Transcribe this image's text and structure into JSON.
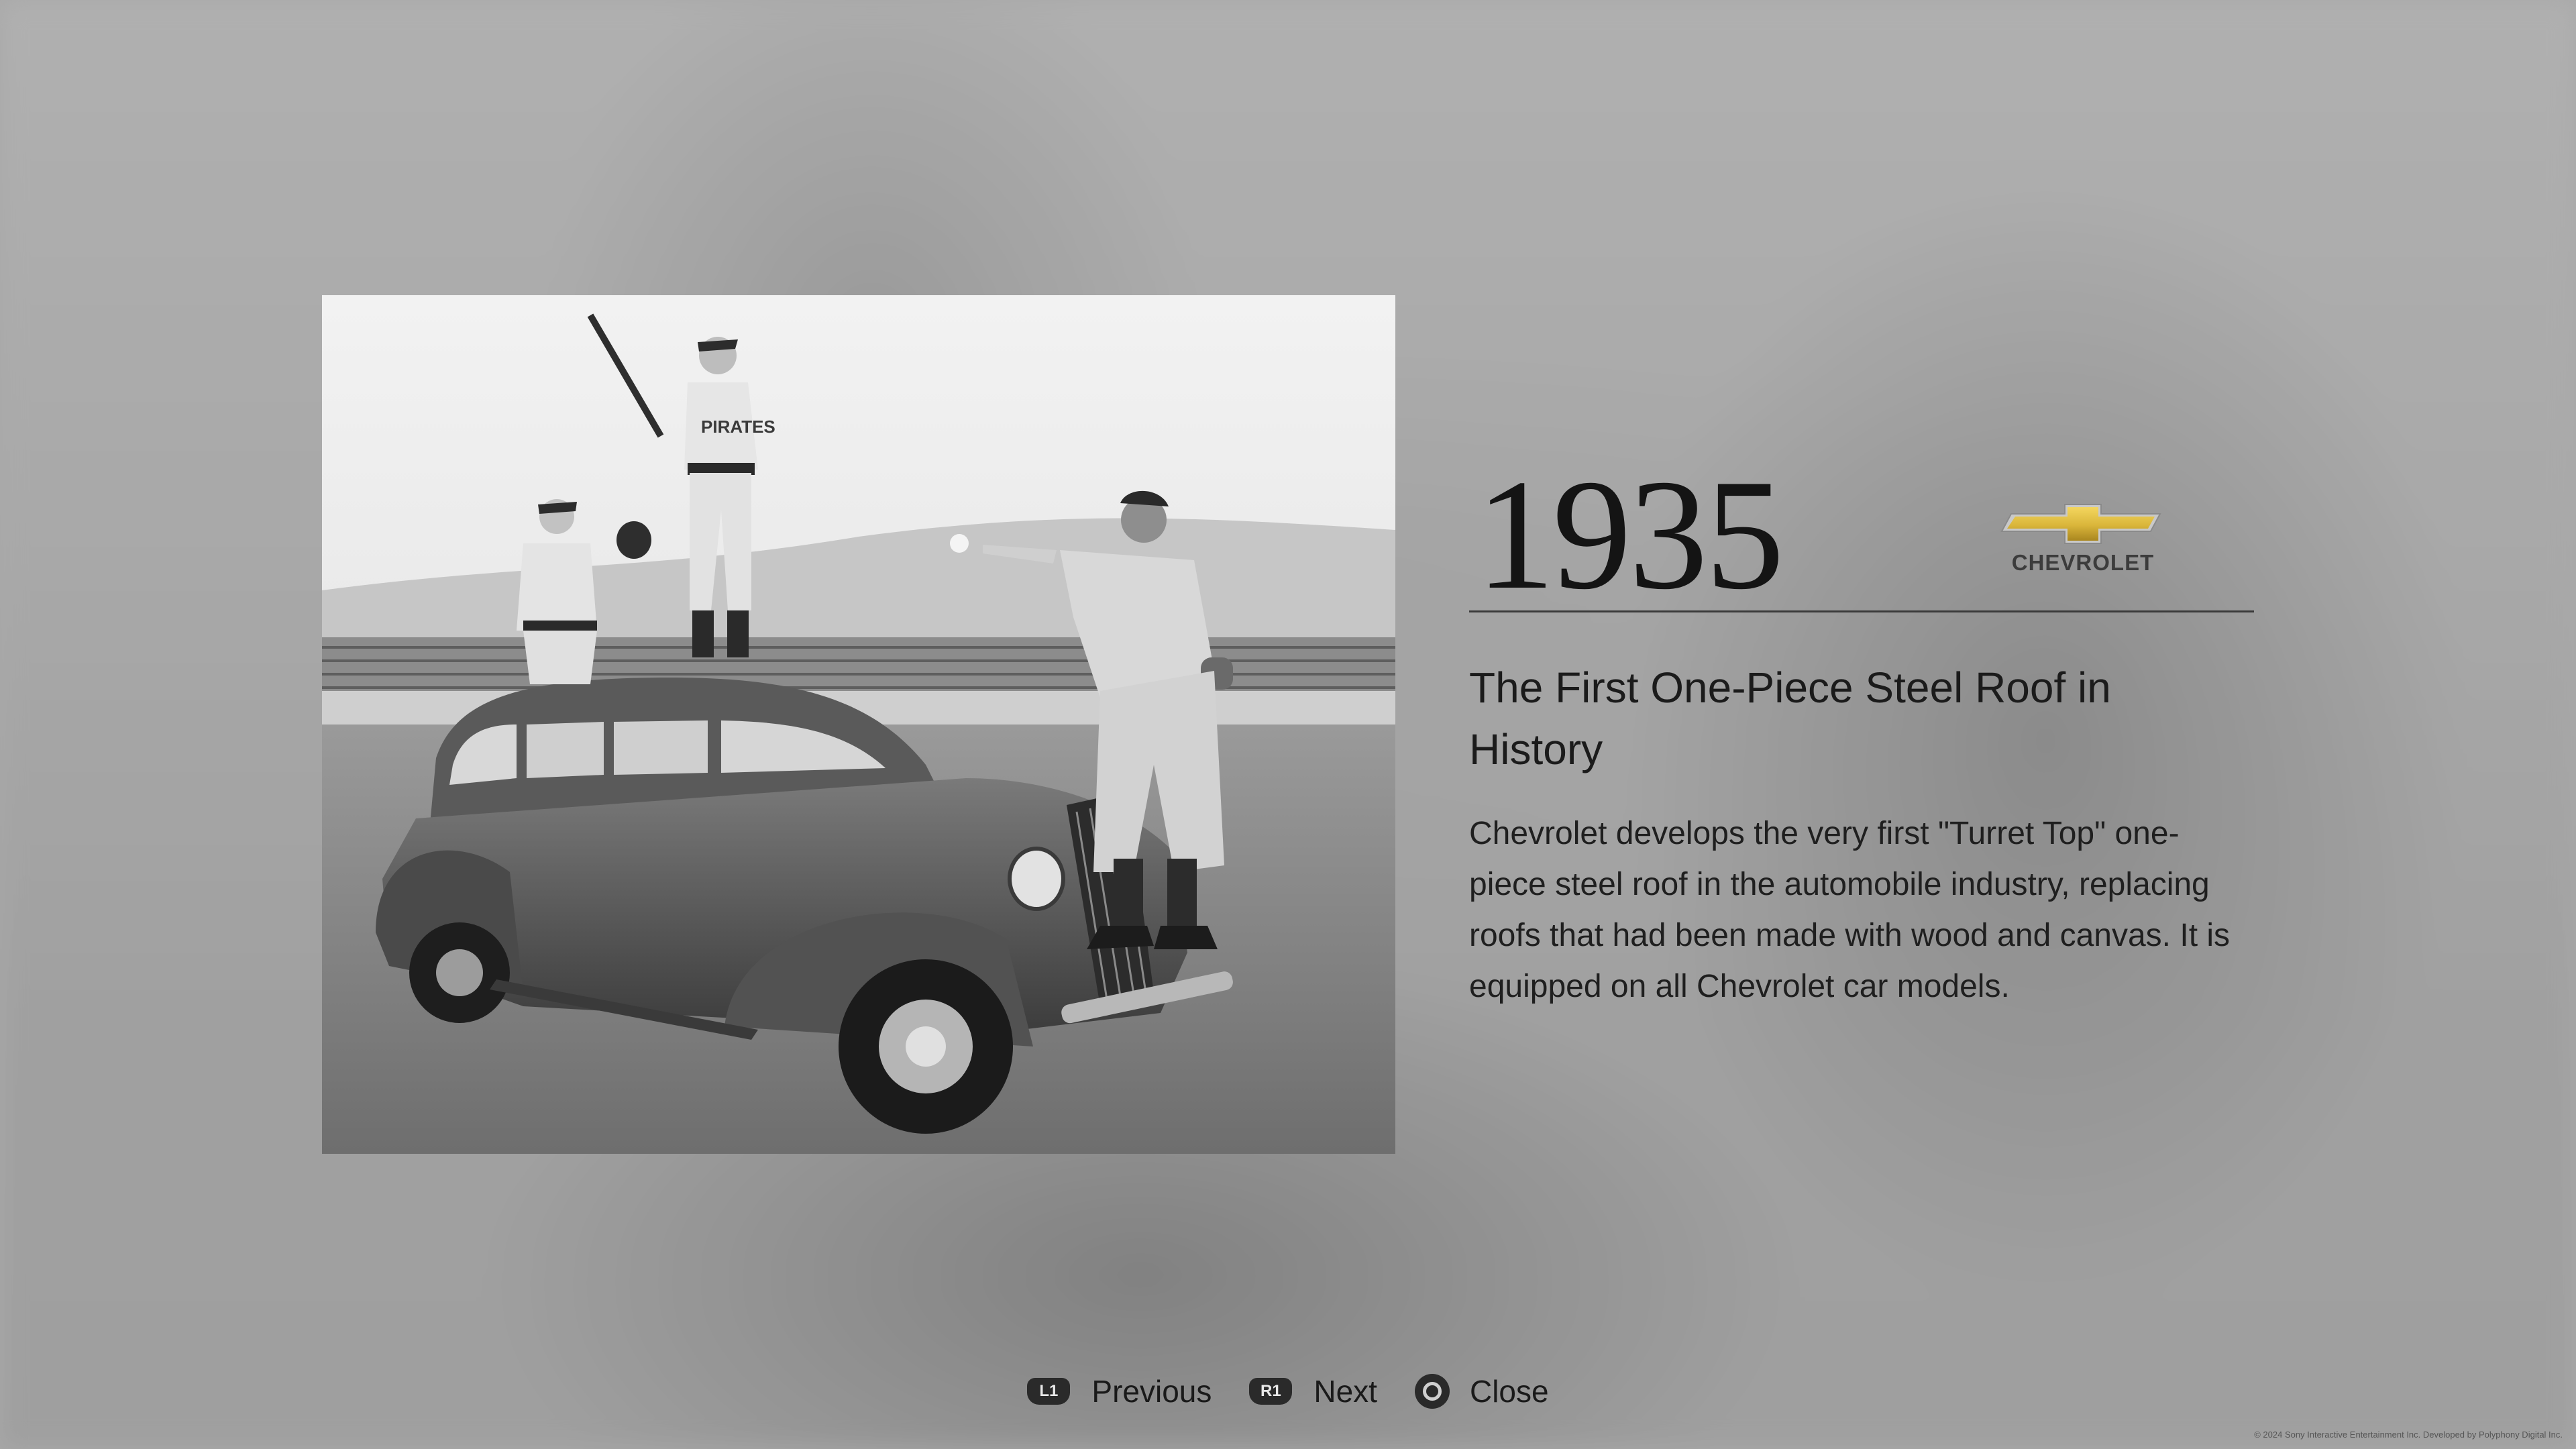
{
  "entry": {
    "year": "1935",
    "brand": {
      "name": "CHEVROLET",
      "logo_icon": "chevrolet-bowtie-logo",
      "logo_color": "#d9b53a"
    },
    "title": "The First One-Piece Steel Roof in History",
    "description": "Chevrolet develops the very first \"Turret Top\" one-piece steel roof in the automobile industry, replacing roofs that had been made with wood and canvas. It is equipped on all Chevrolet car models."
  },
  "photo": {
    "style": "black-and-white",
    "jersey_text": "PIRATES"
  },
  "controls": {
    "previous": {
      "button": "L1",
      "label": "Previous"
    },
    "next": {
      "button": "R1",
      "label": "Next"
    },
    "close": {
      "icon": "circle-button-icon",
      "label": "Close"
    }
  },
  "footer": {
    "copyright": "© 2024 Sony Interactive Entertainment Inc. Developed by Polyphony Digital Inc."
  }
}
